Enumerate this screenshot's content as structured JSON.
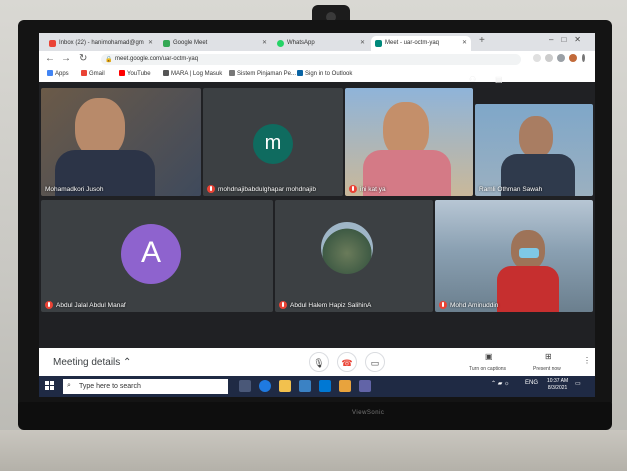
{
  "browser": {
    "tabs": [
      {
        "label": "Inbox (22) - hanimohamad@gm",
        "color": "#ea4335"
      },
      {
        "label": "Google Meet",
        "color": "#34a853"
      },
      {
        "label": "WhatsApp",
        "color": "#25d366"
      },
      {
        "label": "Meet - uar-octm-yaq",
        "color": "#00897b"
      }
    ],
    "url": "meet.google.com/uar-octm-yaq",
    "bookmarks": [
      {
        "label": "Apps",
        "color": "#4285f4"
      },
      {
        "label": "Gmail",
        "color": "#ea4335"
      },
      {
        "label": "YouTube",
        "color": "#ff0000"
      },
      {
        "label": "MARA | Log Masuk",
        "color": "#555555"
      },
      {
        "label": "Sistem Pinjaman Pe...",
        "color": "#777777"
      },
      {
        "label": "Sign in to Outlook",
        "color": "#0a64a4"
      }
    ]
  },
  "meet": {
    "time": "10:37 AM",
    "participants": [
      {
        "name": "Mohamadkori Jusoh",
        "muted": false
      },
      {
        "name": "mohdnajibabdulghapar mohdnajib",
        "avatar_letter": "m",
        "avatar_color": "#0f6b5f",
        "muted": true
      },
      {
        "name": "ini kat ya",
        "muted": true
      },
      {
        "name": "Ramli Othman Sawah",
        "muted": false
      },
      {
        "name": "Abdul Jalal Abdul Manaf",
        "avatar_letter": "A",
        "avatar_color": "#8e63ce",
        "muted": true
      },
      {
        "name": "Abdul Halem Hapiz SalihinA",
        "muted": true
      },
      {
        "name": "Mohd Aminuddin",
        "muted": true
      }
    ],
    "meeting_details_label": "Meeting details",
    "turn_on_captions_label": "Turn on captions",
    "present_now_label": "Present now"
  },
  "taskbar": {
    "search_placeholder": "Type here to search",
    "lang": "ENG",
    "time": "10:37 AM",
    "date": "8/3/2021"
  },
  "monitor": {
    "brand": "ViewSonic"
  }
}
